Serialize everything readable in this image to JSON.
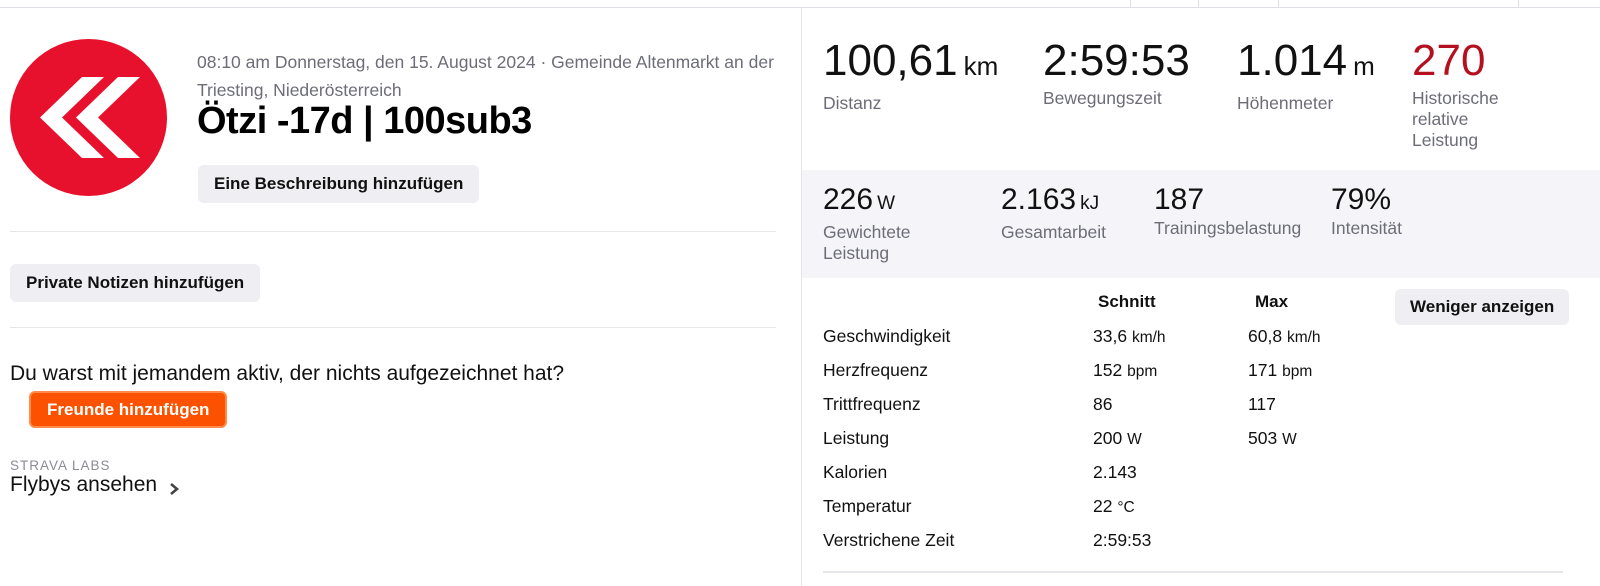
{
  "activity": {
    "date_location": "08:10 am Donnerstag, den 15. August 2024 · Gemeinde Altenmarkt an der Triesting, Niederösterreich",
    "title": "Ötzi -17d | 100sub3",
    "logo_icon": "club-chevron-logo",
    "colors": {
      "logo_red": "#e8112d",
      "accent_orange": "#fc5200",
      "relative_effort_red": "#b4101f"
    }
  },
  "actions": {
    "add_description": "Eine Beschreibung hinzufügen",
    "add_private_notes": "Private Notizen hinzufügen",
    "friends_prompt": "Du warst mit jemandem aktiv, der nichts aufgezeichnet hat?",
    "add_friends": "Freunde hinzufügen",
    "labs_tag": "STRAVA LABS",
    "flybys": "Flybys ansehen"
  },
  "primary_stats": [
    {
      "value": "100,61",
      "unit": "km",
      "label": "Distanz"
    },
    {
      "value": "2:59:53",
      "unit": "",
      "label": "Bewegungszeit"
    },
    {
      "value": "1.014",
      "unit": "m",
      "label": "Höhenmeter"
    },
    {
      "value": "270",
      "unit": "",
      "label_lines": [
        "Historische",
        "relative",
        "Leistung"
      ]
    }
  ],
  "secondary_stats": [
    {
      "value": "226",
      "unit": "W",
      "label_lines": [
        "Gewichtete",
        "Leistung"
      ]
    },
    {
      "value": "2.163",
      "unit": "kJ",
      "label": "Gesamtarbeit"
    },
    {
      "value": "187",
      "unit": "",
      "label": "Trainingsbelastung"
    },
    {
      "value": "79%",
      "unit": "",
      "label": "Intensität"
    }
  ],
  "details": {
    "col_avg": "Schnitt",
    "col_max": "Max",
    "toggle": "Weniger anzeigen",
    "rows": [
      {
        "label": "Geschwindigkeit",
        "avg": "33,6",
        "avg_unit": "km/h",
        "max": "60,8",
        "max_unit": "km/h"
      },
      {
        "label": "Herzfrequenz",
        "avg": "152",
        "avg_unit": "bpm",
        "max": "171",
        "max_unit": "bpm"
      },
      {
        "label": "Trittfrequenz",
        "avg": "86",
        "avg_unit": "",
        "max": "117",
        "max_unit": ""
      },
      {
        "label": "Leistung",
        "avg": "200",
        "avg_unit": "W",
        "max": "503",
        "max_unit": "W"
      },
      {
        "label": "Kalorien",
        "avg": "2.143",
        "avg_unit": "",
        "max": "",
        "max_unit": ""
      },
      {
        "label": "Temperatur",
        "avg": "22",
        "avg_unit": "°C",
        "max": "",
        "max_unit": ""
      },
      {
        "label": "Verstrichene Zeit",
        "avg": "2:59:53",
        "avg_unit": "",
        "max": "",
        "max_unit": ""
      }
    ]
  }
}
